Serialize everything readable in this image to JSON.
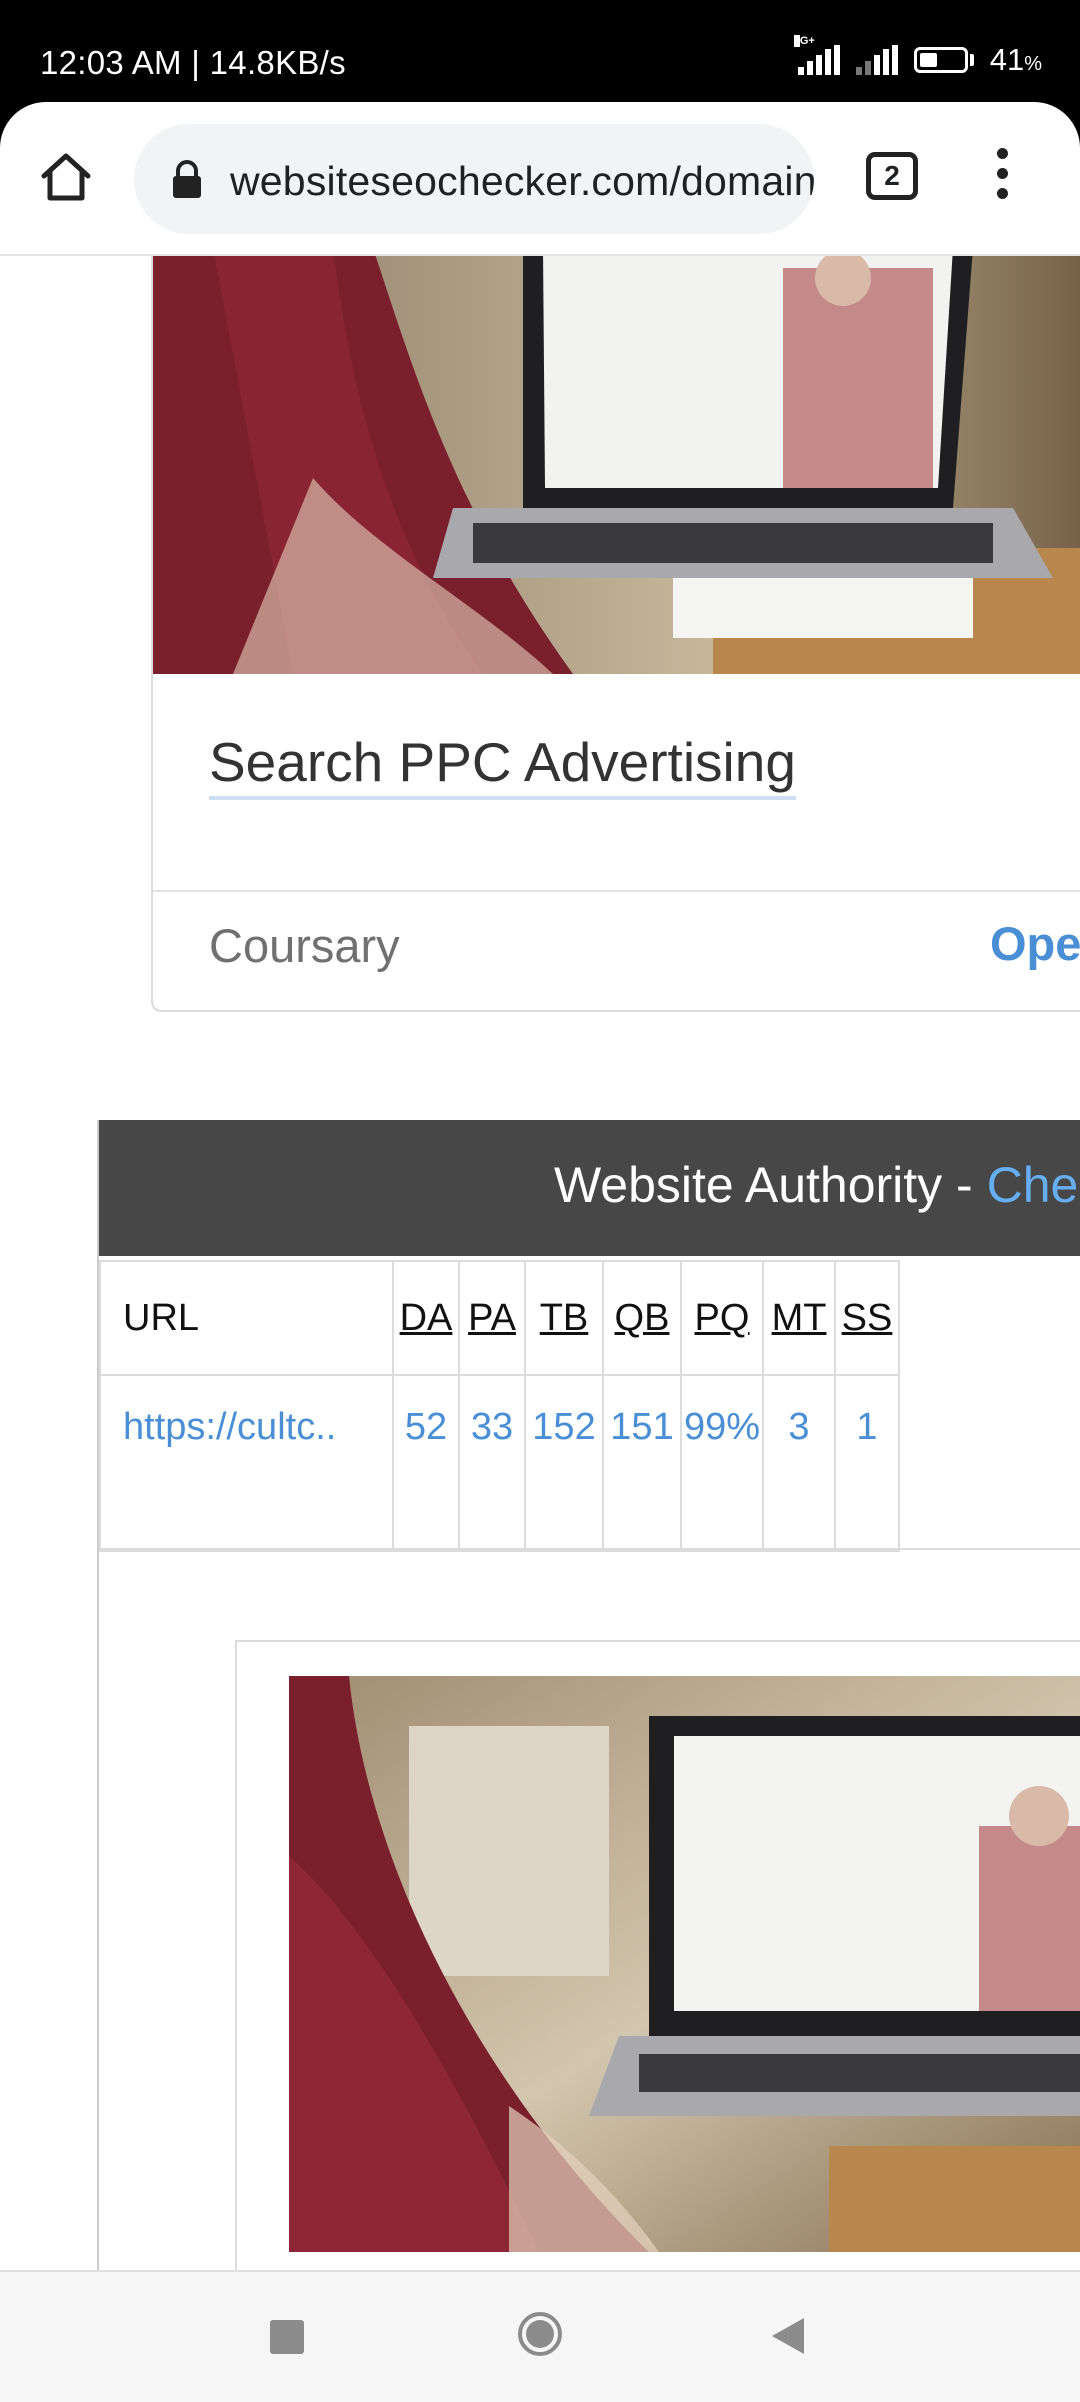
{
  "status_bar": {
    "time": "12:03 AM | 14.8KB/s",
    "network_type": "4G+",
    "battery_percent": "41",
    "battery_unit": "%",
    "battery_level": 0.41
  },
  "browser": {
    "url": "websiteseochecker.com/domain-authority-checker/",
    "tab_count": "2",
    "icons": {
      "home": "home-icon",
      "lock": "lock-icon",
      "menu": "more-vert-icon"
    }
  },
  "course_card": {
    "title": "Search PPC Advertising",
    "provider": "Coursary",
    "action": "Open"
  },
  "authority": {
    "title_prefix": "Website Authority - ",
    "title_link": "Check",
    "columns": [
      "URL",
      "DA",
      "PA",
      "TB",
      "QB",
      "PQ",
      "MT",
      "SS"
    ],
    "rows": [
      [
        "https://cultc..",
        "52",
        "33",
        "152",
        "151",
        "99%",
        "3",
        "1"
      ]
    ]
  },
  "colors": {
    "link": "#4a8fd6",
    "header_bg": "#474747",
    "header_link": "#66aef0"
  },
  "nav_bar": {
    "icons": [
      "recents-icon",
      "home-circle-icon",
      "back-icon"
    ]
  }
}
